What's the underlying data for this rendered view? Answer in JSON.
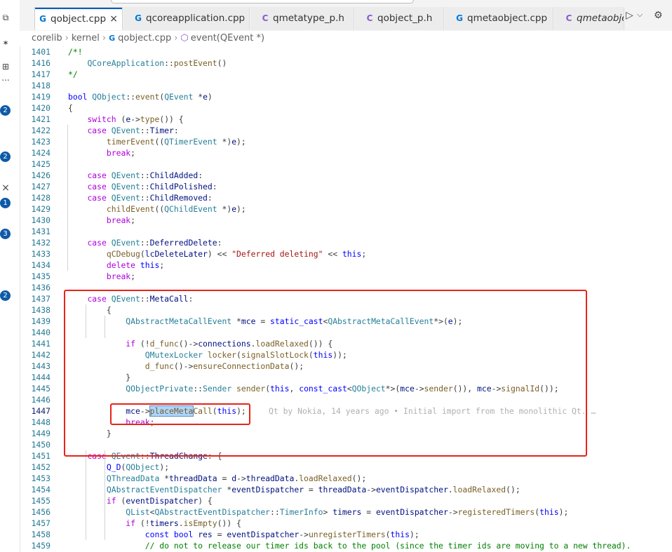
{
  "tabs": [
    {
      "label": "qobject.cpp",
      "icon": "cpp",
      "active": true,
      "close": "×"
    },
    {
      "label": "qcoreapplication.cpp",
      "icon": "cpp",
      "active": false
    },
    {
      "label": "qmetatype_p.h",
      "icon": "h",
      "active": false
    },
    {
      "label": "qobject_p.h",
      "icon": "h",
      "active": false
    },
    {
      "label": "qmetaobject.cpp",
      "icon": "cpp",
      "active": false
    },
    {
      "label": "qmetaobjec",
      "icon": "h",
      "active": false
    }
  ],
  "icon_glyphs": {
    "cpp": "G",
    "h": "C"
  },
  "toolbar": {
    "run_icon": "▷",
    "chevron": "⌵",
    "gear_icon": "⚙"
  },
  "breadcrumb": {
    "part1": "corelib",
    "part2": "kernel",
    "file": "qobject.cpp",
    "symbol": "event(QEvent *)"
  },
  "activity_bar": {
    "badges": [
      "2",
      "2",
      "1",
      "3",
      "2"
    ],
    "close_glyph": "×",
    "star": "*",
    "dots": "..."
  },
  "blame": "Qt by Nokia, 14 years ago • Initial import from the monolithic Qt. …",
  "code_lines": [
    {
      "n": "1401",
      "text": "/*!"
    },
    {
      "n": "1416",
      "text": "    QCoreApplication::postEvent()"
    },
    {
      "n": "1417",
      "text": "*/"
    },
    {
      "n": "1418",
      "text": ""
    },
    {
      "n": "1419",
      "text": "bool QObject::event(QEvent *e)"
    },
    {
      "n": "1420",
      "text": "{"
    },
    {
      "n": "1421",
      "text": "    switch (e->type()) {"
    },
    {
      "n": "1422",
      "text": "    case QEvent::Timer:"
    },
    {
      "n": "1423",
      "text": "        timerEvent((QTimerEvent *)e);"
    },
    {
      "n": "1424",
      "text": "        break;"
    },
    {
      "n": "1425",
      "text": ""
    },
    {
      "n": "1426",
      "text": "    case QEvent::ChildAdded:"
    },
    {
      "n": "1427",
      "text": "    case QEvent::ChildPolished:"
    },
    {
      "n": "1428",
      "text": "    case QEvent::ChildRemoved:"
    },
    {
      "n": "1429",
      "text": "        childEvent((QChildEvent *)e);"
    },
    {
      "n": "1430",
      "text": "        break;"
    },
    {
      "n": "1431",
      "text": ""
    },
    {
      "n": "1432",
      "text": "    case QEvent::DeferredDelete:"
    },
    {
      "n": "1433",
      "text": "        qCDebug(lcDeleteLater) << \"Deferred deleting\" << this;"
    },
    {
      "n": "1434",
      "text": "        delete this;"
    },
    {
      "n": "1435",
      "text": "        break;"
    },
    {
      "n": "1436",
      "text": ""
    },
    {
      "n": "1437",
      "text": "    case QEvent::MetaCall:"
    },
    {
      "n": "1438",
      "text": "        {"
    },
    {
      "n": "1439",
      "text": "            QAbstractMetaCallEvent *mce = static_cast<QAbstractMetaCallEvent*>(e);"
    },
    {
      "n": "1440",
      "text": ""
    },
    {
      "n": "1441",
      "text": "            if (!d_func()->connections.loadRelaxed()) {"
    },
    {
      "n": "1442",
      "text": "                QMutexLocker locker(signalSlotLock(this));"
    },
    {
      "n": "1443",
      "text": "                d_func()->ensureConnectionData();"
    },
    {
      "n": "1444",
      "text": "            }"
    },
    {
      "n": "1445",
      "text": "            QObjectPrivate::Sender sender(this, const_cast<QObject*>(mce->sender()), mce->signalId());"
    },
    {
      "n": "1446",
      "text": ""
    },
    {
      "n": "1447",
      "text": "            mce->placeMetaCall(this);"
    },
    {
      "n": "1448",
      "text": "            break;"
    },
    {
      "n": "1449",
      "text": "        }"
    },
    {
      "n": "1450",
      "text": ""
    },
    {
      "n": "1451",
      "text": "    case QEvent::ThreadChange: {"
    },
    {
      "n": "1452",
      "text": "        Q_D(QObject);"
    },
    {
      "n": "1453",
      "text": "        QThreadData *threadData = d->threadData.loadRelaxed();"
    },
    {
      "n": "1454",
      "text": "        QAbstractEventDispatcher *eventDispatcher = threadData->eventDispatcher.loadRelaxed();"
    },
    {
      "n": "1455",
      "text": "        if (eventDispatcher) {"
    },
    {
      "n": "1456",
      "text": "            QList<QAbstractEventDispatcher::TimerInfo> timers = eventDispatcher->registeredTimers(this);"
    },
    {
      "n": "1457",
      "text": "            if (!timers.isEmpty()) {"
    },
    {
      "n": "1458",
      "text": "                const bool res = eventDispatcher->unregisterTimers(this);"
    },
    {
      "n": "1459",
      "text": "                // do not to release our timer ids back to the pool (since the timer ids are moving to a new thread)."
    }
  ]
}
